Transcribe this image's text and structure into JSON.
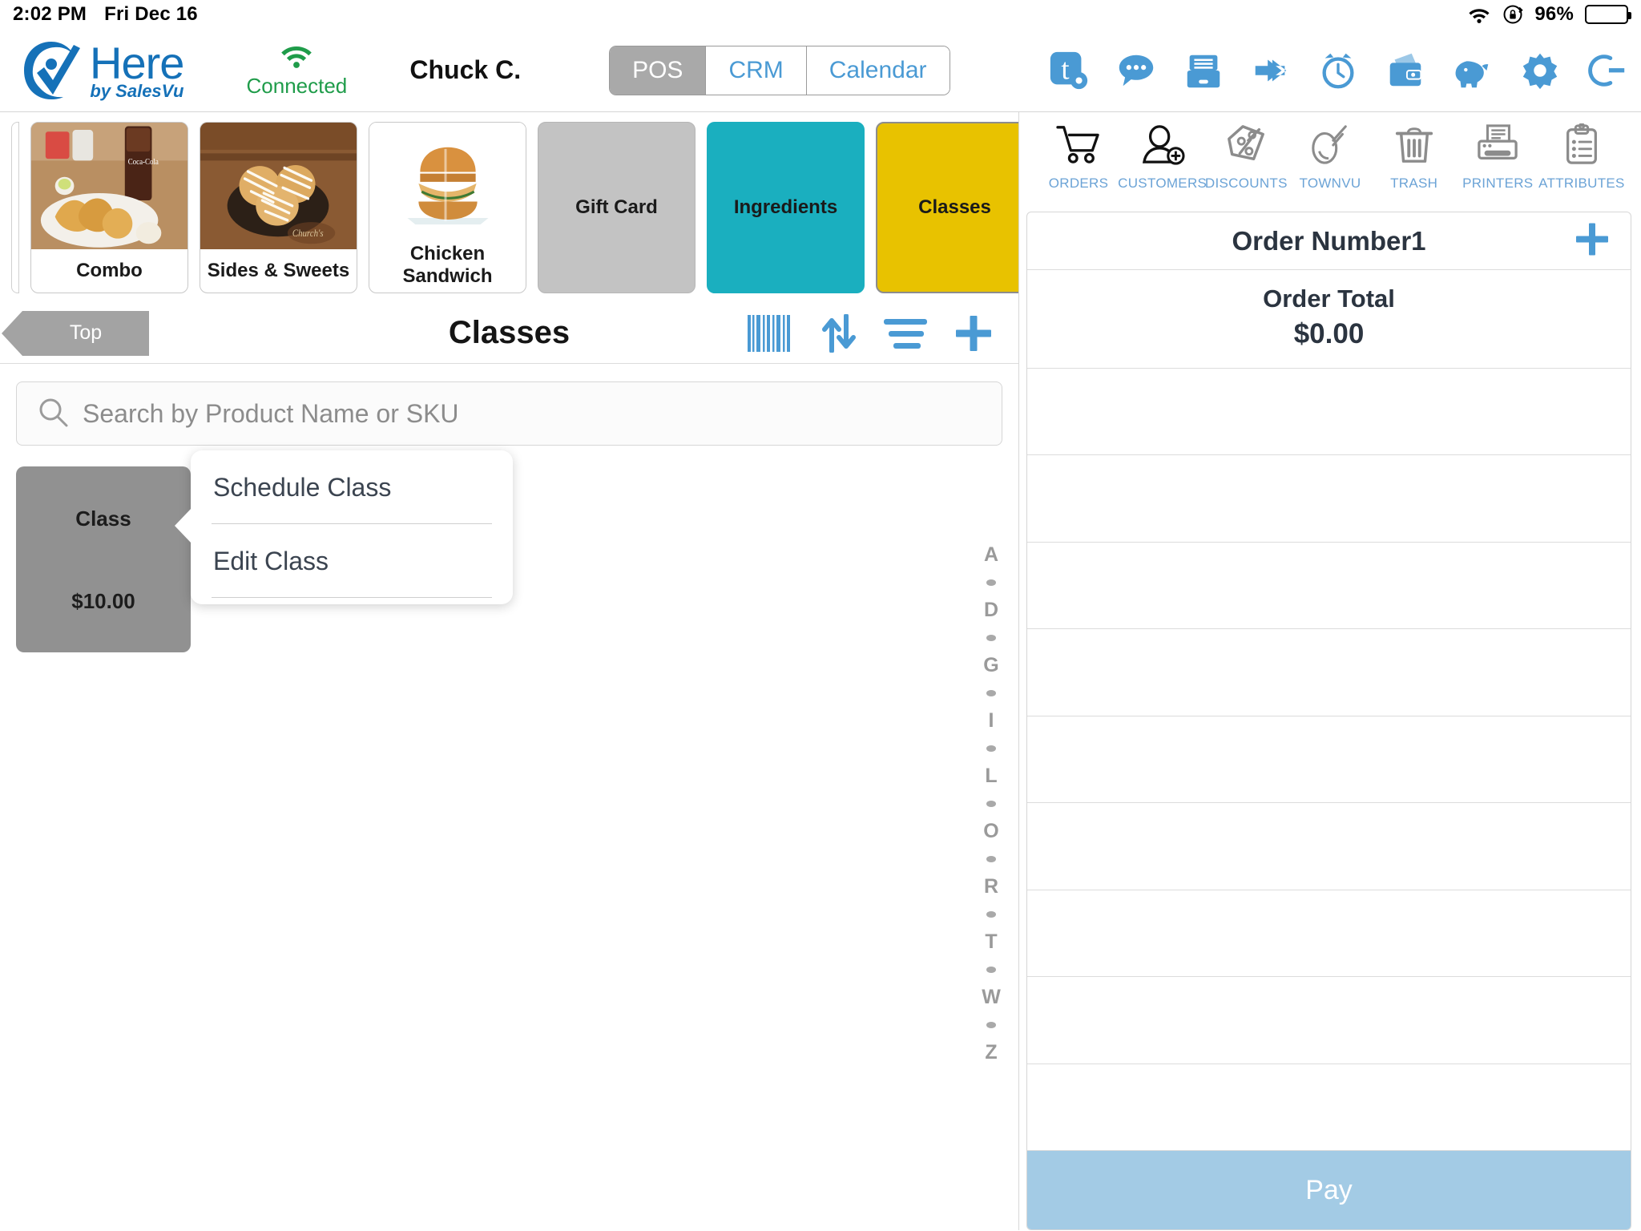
{
  "status_bar": {
    "time": "2:02 PM",
    "date": "Fri Dec 16",
    "battery_percent": "96%",
    "wifi_icon": "wifi-icon",
    "lock_icon": "rotation-lock-icon",
    "battery_icon": "battery-icon"
  },
  "header": {
    "logo_primary": "Here",
    "logo_secondary": "by SalesVu",
    "connection_status": "Connected",
    "user_name": "Chuck C.",
    "segments": [
      {
        "label": "POS",
        "active": true
      },
      {
        "label": "CRM",
        "active": false
      },
      {
        "label": "Calendar",
        "active": false
      }
    ],
    "icons": [
      {
        "name": "tools-settings-icon"
      },
      {
        "name": "chat-bubble-icon"
      },
      {
        "name": "file-drawer-icon"
      },
      {
        "name": "exchange-arrows-icon"
      },
      {
        "name": "alarm-clock-icon"
      },
      {
        "name": "wallet-cash-icon"
      },
      {
        "name": "piggy-bank-icon"
      },
      {
        "name": "gear-icon"
      },
      {
        "name": "logout-icon"
      }
    ],
    "accent_blue": "#4a9ad4",
    "green": "#1f9c4a"
  },
  "categories": [
    {
      "label": "Combo",
      "style": "photo",
      "photo": "fried-chicken-combo"
    },
    {
      "label": "Sides & Sweets",
      "style": "photo",
      "photo": "dessert-biscuits"
    },
    {
      "label": "Chicken Sandwich",
      "style": "photo",
      "photo": "chicken-sandwich"
    },
    {
      "label": "Gift Card",
      "style": "solid",
      "color": "#c3c3c3"
    },
    {
      "label": "Ingredients",
      "style": "solid",
      "color": "#1aafbf"
    },
    {
      "label": "Classes",
      "style": "solid",
      "color": "#e8c200",
      "selected": true
    }
  ],
  "subbar": {
    "back_label": "Top",
    "title": "Classes",
    "actions": [
      {
        "name": "barcode-icon"
      },
      {
        "name": "sort-arrows-icon"
      },
      {
        "name": "list-menu-icon"
      },
      {
        "name": "plus-icon"
      }
    ]
  },
  "search": {
    "placeholder": "Search by Product Name or SKU",
    "value": "",
    "icon": "search-icon"
  },
  "product": {
    "name": "Class",
    "price": "$10.00"
  },
  "context_menu": {
    "items": [
      {
        "label": "Schedule Class"
      },
      {
        "label": "Edit Class"
      }
    ]
  },
  "alpha_index": [
    "A",
    "•",
    "D",
    "•",
    "G",
    "•",
    "I",
    "•",
    "L",
    "•",
    "O",
    "•",
    "R",
    "•",
    "T",
    "•",
    "W",
    "•",
    "Z"
  ],
  "right_toolbar": [
    {
      "label": "ORDERS",
      "icon": "shopping-cart-icon"
    },
    {
      "label": "CUSTOMERS",
      "icon": "add-customer-icon"
    },
    {
      "label": "DISCOUNTS",
      "icon": "discount-tag-icon"
    },
    {
      "label": "TOWNVU",
      "icon": "townvu-icon"
    },
    {
      "label": "TRASH",
      "icon": "trash-icon"
    },
    {
      "label": "PRINTERS",
      "icon": "printer-icon"
    },
    {
      "label": "ATTRIBUTES",
      "icon": "clipboard-list-icon"
    }
  ],
  "order": {
    "number_label": "Order Number1",
    "add_icon": "plus-icon",
    "total_label": "Order Total",
    "total_value": "$0.00",
    "line_count": 9,
    "pay_label": "Pay",
    "pay_color": "#a3cbe5"
  }
}
